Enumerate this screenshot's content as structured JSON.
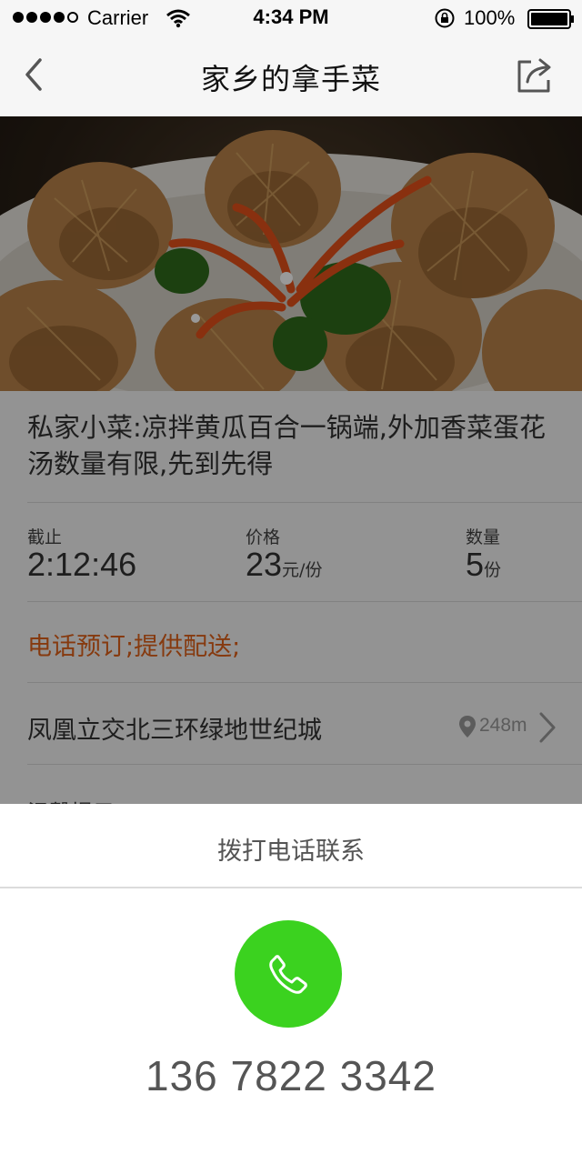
{
  "status_bar": {
    "carrier": "Carrier",
    "time": "4:34 PM",
    "battery": "100%"
  },
  "nav": {
    "title": "家乡的拿手菜",
    "back_icon": "chevron-left-icon",
    "share_icon": "share-icon"
  },
  "dish": {
    "title": "私家小菜:凉拌黄瓜百合一锅端,外加香菜蛋花汤数量有限,先到先得"
  },
  "info": {
    "deadline_label": "截止",
    "deadline_value": "2:12:46",
    "price_label": "价格",
    "price_value": "23",
    "price_unit": "元/份",
    "quantity_label": "数量",
    "quantity_value": "5",
    "quantity_unit": "份"
  },
  "service": {
    "text": "电话预订;提供配送;"
  },
  "location": {
    "address": "凤凰立交北三环绿地世纪城",
    "distance": "248m"
  },
  "tip": {
    "label": "温馨提示"
  },
  "sheet": {
    "title": "拨打电话联系",
    "phone_number": "136 7822 3342"
  },
  "colors": {
    "accent_orange": "#e0621a",
    "call_green": "#3bd21f"
  }
}
